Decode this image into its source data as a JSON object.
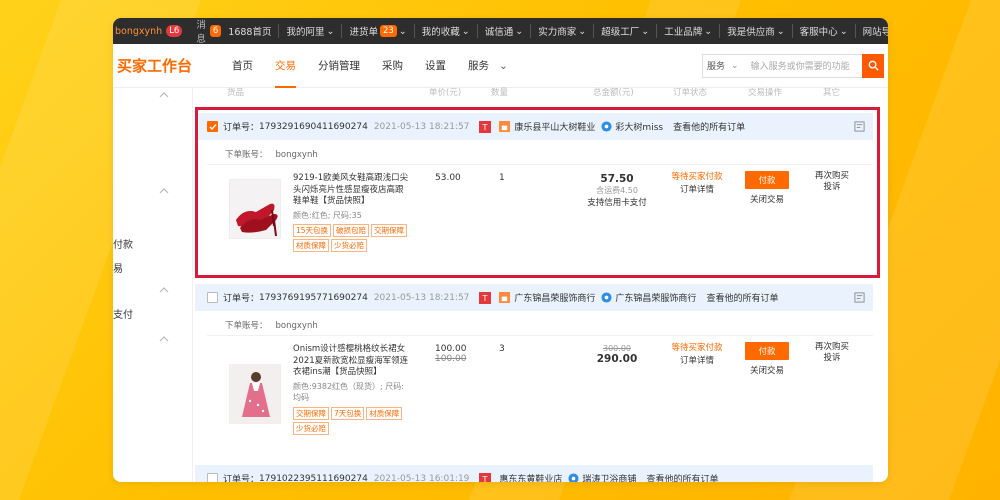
{
  "topbar": {
    "username": "bongxynh",
    "badge": "L6",
    "messages_label": "消息",
    "messages_count": "6",
    "links": [
      "1688首页",
      "我的阿里",
      "进货单",
      "我的收藏",
      "诚信通",
      "实力商家",
      "超级工厂",
      "工业品牌",
      "我是供应商",
      "客服中心",
      "网站导航"
    ],
    "cart_count": "23"
  },
  "header": {
    "brand": "买家工作台",
    "nav": [
      "首页",
      "交易",
      "分销管理",
      "采购",
      "设置",
      "服务"
    ],
    "active_nav": "交易",
    "search_scope": "服务",
    "search_placeholder": "输入服务或你需要的功能"
  },
  "columns": [
    "货品",
    "单价(元)",
    "数量",
    "总金额(元)",
    "订单状态",
    "交易操作",
    "其它"
  ],
  "sidebar": {
    "items": [
      "付款",
      "易",
      "支付"
    ]
  },
  "orders": [
    {
      "checked": true,
      "order_no_label": "订单号：",
      "order_no": "1793291690411690274",
      "time": "2021-05-13 18:21:57",
      "shop": "康乐县平山大树鞋业",
      "wangwang": "彩大树miss",
      "all_orders": "查看他的所有订单",
      "sub_account_label": "下单账号：",
      "sub_account": "bongxynh",
      "product_name": "9219-1欧美风女鞋高跟浅口尖头闪烁亮片性感显瘦夜店高跟鞋单鞋【货品快照】",
      "product_attr": "颜色:红色; 尺码:35",
      "tags": [
        "15天包换",
        "破损包赔",
        "交期保障",
        "材质保障",
        "少货必赔"
      ],
      "unit_price": "53.00",
      "unit_price_orig": "",
      "qty": "1",
      "total": "57.50",
      "total_orig": "",
      "shipping": "含运费4.50",
      "pay_note": "支持信用卡支付",
      "status": "等待买家付款",
      "status_detail": "订单详情",
      "pay_button": "付款",
      "close_label": "关闭交易",
      "other_1": "再次购买",
      "other_2": "投诉"
    },
    {
      "checked": false,
      "order_no_label": "订单号：",
      "order_no": "1793769195771690274",
      "time": "2021-05-13 18:21:57",
      "shop": "广东锦昌荣服饰商行",
      "wangwang": "广东锦昌荣服饰商行",
      "all_orders": "查看他的所有订单",
      "sub_account_label": "下单账号：",
      "sub_account": "bongxynh",
      "product_name": "Onism设计感樱桃格纹长裙女2021夏新款宽松显瘦海军领连衣裙ins潮【货品快照】",
      "product_attr": "颜色:9382红色（现货）; 尺码:均码",
      "tags": [
        "交期保障",
        "7天包换",
        "材质保障",
        "少货必赔"
      ],
      "unit_price": "100.00",
      "unit_price_orig": "100.00",
      "qty": "3",
      "total": "290.00",
      "total_orig": "300.00",
      "shipping": "",
      "pay_note": "",
      "status": "等待买家付款",
      "status_detail": "订单详情",
      "pay_button": "付款",
      "close_label": "关闭交易",
      "other_1": "再次购买",
      "other_2": "投诉"
    },
    {
      "checked": false,
      "order_no_label": "订单号：",
      "order_no": "1791022395111690274",
      "time": "2021-05-13 16:01:19",
      "shop": "惠东东黄鞋业店",
      "wangwang": "瑞涛卫浴商铺",
      "all_orders": "查看他的所有订单"
    }
  ],
  "colors": {
    "accent": "#ff6a00",
    "highlight": "#d7193a",
    "order_header_bg": "#eaf3fd"
  }
}
